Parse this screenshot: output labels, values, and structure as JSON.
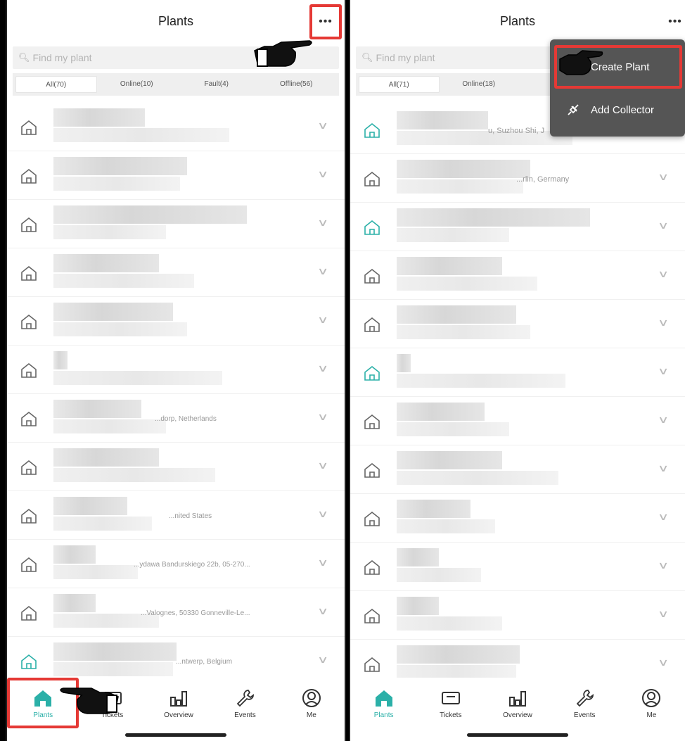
{
  "left": {
    "title": "Plants",
    "more_label": "•••",
    "search_placeholder": "Find my plant",
    "tabs": [
      {
        "label": "All(70)",
        "active": true
      },
      {
        "label": "Online(10)",
        "active": false
      },
      {
        "label": "Fault(4)",
        "active": false
      },
      {
        "label": "Offline(56)",
        "active": false
      }
    ],
    "rows": [
      {
        "addr": "",
        "teal": false
      },
      {
        "addr": "",
        "teal": false
      },
      {
        "addr": "",
        "teal": false
      },
      {
        "addr": "",
        "teal": false
      },
      {
        "addr": "",
        "teal": false
      },
      {
        "addr": "",
        "teal": false
      },
      {
        "addr": "...dorp, Netherlands",
        "teal": false
      },
      {
        "addr": "",
        "teal": false
      },
      {
        "addr": "...nited States",
        "teal": false
      },
      {
        "addr": "...ydawa Bandurskiego 22b, 05-270...",
        "teal": false
      },
      {
        "addr": "...Valognes, 50330 Gonneville-Le...",
        "teal": false
      },
      {
        "addr": "...ntwerp, Belgium",
        "teal": true
      }
    ]
  },
  "right": {
    "title": "Plants",
    "more_label": "•••",
    "search_placeholder": "Find my plant",
    "tabs": [
      {
        "label": "All(71)",
        "active": true
      },
      {
        "label": "Online(18)",
        "active": false
      },
      {
        "label": "",
        "active": false
      },
      {
        "label": "",
        "active": false
      }
    ],
    "menu": {
      "create_plant": "Create Plant",
      "add_collector": "Add Collector"
    },
    "rows": [
      {
        "addr": "u, Suzhou Shi, J",
        "teal": true
      },
      {
        "addr": "...rlin, Germany",
        "teal": false
      },
      {
        "addr": "",
        "teal": true
      },
      {
        "addr": "",
        "teal": false
      },
      {
        "addr": "",
        "teal": false
      },
      {
        "addr": "",
        "teal": true
      },
      {
        "addr": "",
        "teal": false
      },
      {
        "addr": "",
        "teal": false
      },
      {
        "addr": "",
        "teal": false
      },
      {
        "addr": "",
        "teal": false
      },
      {
        "addr": "",
        "teal": false
      },
      {
        "addr": "",
        "teal": false
      }
    ]
  },
  "nav": [
    "Plants",
    "Tickets",
    "Overview",
    "Events",
    "Me"
  ],
  "colors": {
    "accent": "#2bb0a8",
    "highlight": "#e53935",
    "menu_bg": "#555555"
  }
}
